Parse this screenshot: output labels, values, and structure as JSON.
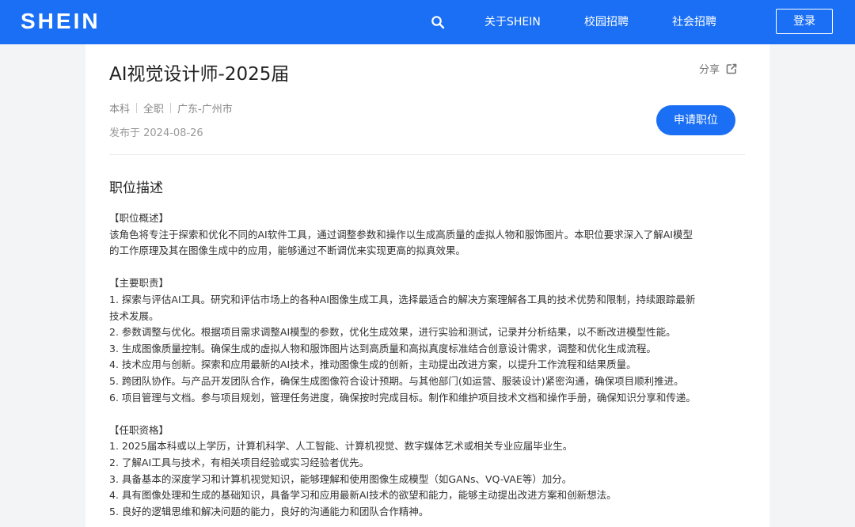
{
  "header": {
    "logo": "SHEIN",
    "nav": [
      "关于SHEIN",
      "校园招聘",
      "社会招聘"
    ],
    "login_label": "登录"
  },
  "job": {
    "title": "AI视觉设计师-2025届",
    "share_label": "分享",
    "tags": [
      "本科",
      "全职",
      "广东-广州市"
    ],
    "publish_date": "发布于 2024-08-26",
    "apply_label": "申请职位",
    "section_title": "职位描述",
    "overview_heading": "【职位概述】",
    "overview_lines": [
      "该角色将专注于探索和优化不同的AI软件工具，通过调整参数和操作以生成高质量的虚拟人物和服饰图片。本职位要求深入了解AI模型",
      "的工作原理及其在图像生成中的应用，能够通过不断调优来实现更高的拟真效果。"
    ],
    "duties_heading": "【主要职责】",
    "duties_lines": [
      "1. 探索与评估AI工具。研究和评估市场上的各种AI图像生成工具，选择最适合的解决方案理解各工具的技术优势和限制，持续跟踪最新",
      "技术发展。",
      "2. 参数调整与优化。根据项目需求调整AI模型的参数，优化生成效果，进行实验和测试，记录并分析结果，以不断改进模型性能。",
      "3. 生成图像质量控制。确保生成的虚拟人物和服饰图片达到高质量和高拟真度标准结合创意设计需求，调整和优化生成流程。",
      "4. 技术应用与创新。探索和应用最新的AI技术，推动图像生成的创新，主动提出改进方案，以提升工作流程和结果质量。",
      "5. 跨团队协作。与产品开发团队合作，确保生成图像符合设计预期。与其他部门(如运营、服装设计)紧密沟通，确保项目顺利推进。",
      "6. 项目管理与文档。参与项目规划，管理任务进度，确保按时完成目标。制作和维护项目技术文档和操作手册，确保知识分享和传递。"
    ],
    "requirements_heading": "【任职资格】",
    "requirements_lines": [
      "1. 2025届本科或以上学历，计算机科学、人工智能、计算机视觉、数字媒体艺术或相关专业应届毕业生。",
      "2. 了解AI工具与技术，有相关项目经验或实习经验者优先。",
      "3. 具备基本的深度学习和计算机视觉知识，能够理解和使用图像生成模型（如GANs、VQ-VAE等）加分。",
      "4. 具有图像处理和生成的基础知识，具备学习和应用最新AI技术的欲望和能力，能够主动提出改进方案和创新想法。",
      "5. 良好的逻辑思维和解决问题的能力，良好的沟通能力和团队合作精神。"
    ]
  },
  "colors": {
    "brand_blue": "#1a6ff5",
    "page_bg": "#f3f4f6"
  },
  "icons": {
    "search": "search-icon",
    "share": "external-share-icon"
  }
}
